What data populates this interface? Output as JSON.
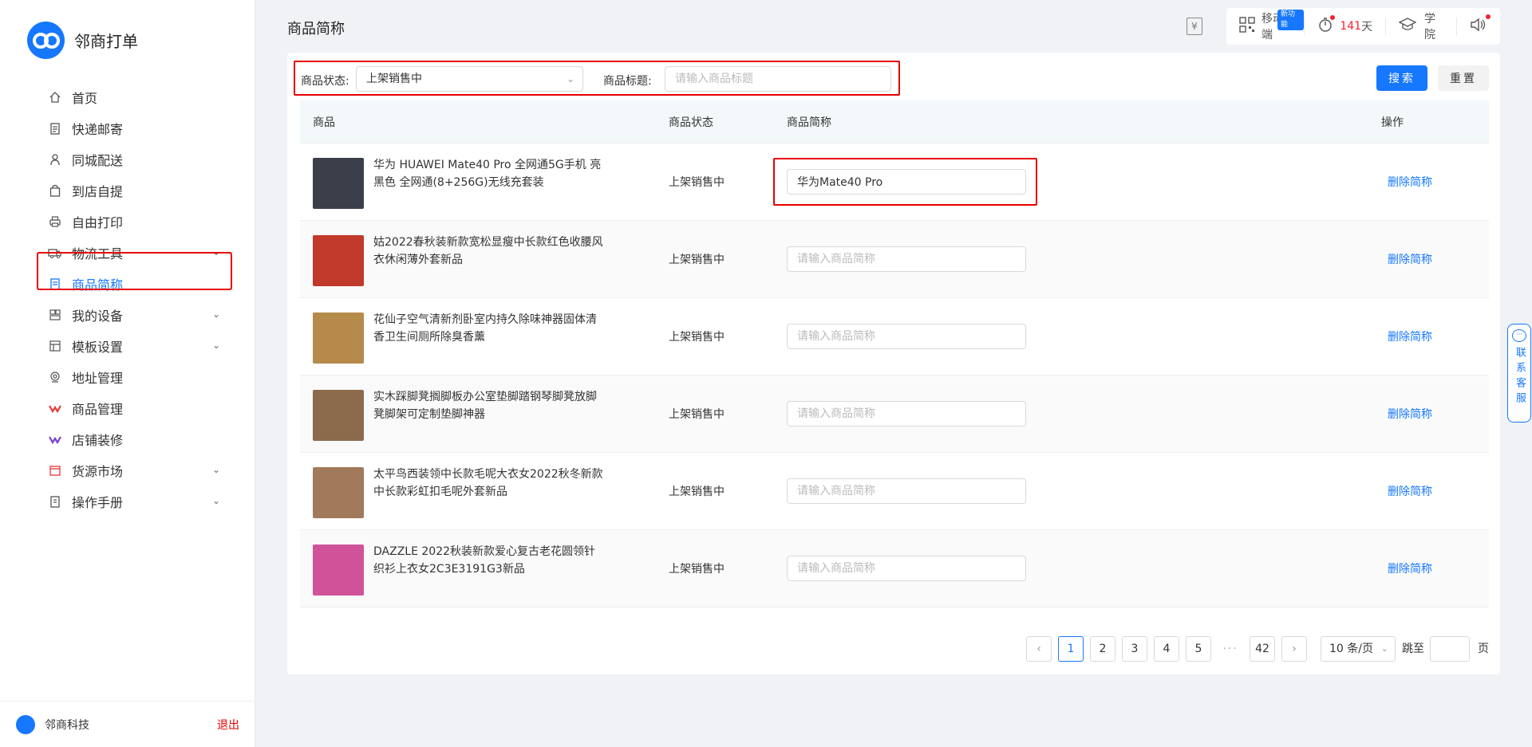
{
  "app": {
    "name": "邻商打单"
  },
  "sidebar": {
    "items": [
      {
        "label": "首页",
        "icon": "home-icon",
        "expandable": false
      },
      {
        "label": "快递邮寄",
        "icon": "clipboard-icon",
        "expandable": false
      },
      {
        "label": "同城配送",
        "icon": "person-icon",
        "expandable": false
      },
      {
        "label": "到店自提",
        "icon": "bag-icon",
        "expandable": false
      },
      {
        "label": "自由打印",
        "icon": "printer-icon",
        "expandable": false
      },
      {
        "label": "物流工具",
        "icon": "truck-icon",
        "expandable": true
      },
      {
        "label": "商品简称",
        "icon": "document-icon",
        "expandable": false,
        "active": true
      },
      {
        "label": "我的设备",
        "icon": "devices-icon",
        "expandable": true
      },
      {
        "label": "模板设置",
        "icon": "template-icon",
        "expandable": true
      },
      {
        "label": "地址管理",
        "icon": "location-icon",
        "expandable": false
      },
      {
        "label": "商品管理",
        "icon": "goods-icon",
        "expandable": false
      },
      {
        "label": "店铺装修",
        "icon": "shop-decor-icon",
        "expandable": false
      },
      {
        "label": "货源市场",
        "icon": "market-icon",
        "expandable": true
      },
      {
        "label": "操作手册",
        "icon": "manual-icon",
        "expandable": true
      }
    ],
    "footer": {
      "company": "邻商科技",
      "logout": "退出"
    }
  },
  "header": {
    "title": "商品简称",
    "toolbar": {
      "mobile_label": "移动端",
      "new_badge": "新功能",
      "timer_value": "141",
      "timer_unit": "天",
      "academy_label": "学院"
    }
  },
  "filters": {
    "status_label": "商品状态:",
    "status_value": "上架销售中",
    "title_label": "商品标题:",
    "title_placeholder": "请输入商品标题",
    "search_button": "搜索",
    "reset_button": "重置"
  },
  "table": {
    "columns": [
      "商品",
      "商品状态",
      "商品简称",
      "操作"
    ],
    "short_placeholder": "请输入商品简称",
    "delete_label": "删除简称",
    "rows": [
      {
        "name": "华为 HUAWEI Mate40 Pro 全网通5G手机 亮黑色 全网通(8+256G)无线充套装",
        "status": "上架销售中",
        "short_name": "华为Mate40 Pro",
        "thumb_color": "#3a3f4a"
      },
      {
        "name": "姑2022春秋装新款宽松显瘦中长款红色收腰风衣休闲薄外套新品",
        "status": "上架销售中",
        "short_name": "",
        "thumb_color": "#c0392b"
      },
      {
        "name": "花仙子空气清新剂卧室内持久除味神器固体清香卫生间厕所除臭香薰",
        "status": "上架销售中",
        "short_name": "",
        "thumb_color": "#b58a4a"
      },
      {
        "name": "实木踩脚凳搁脚板办公室垫脚踏钢琴脚凳放脚凳脚架可定制垫脚神器",
        "status": "上架销售中",
        "short_name": "",
        "thumb_color": "#8c6a4c"
      },
      {
        "name": "太平鸟西装领中长款毛呢大衣女2022秋冬新款中长款彩虹扣毛呢外套新品",
        "status": "上架销售中",
        "short_name": "",
        "thumb_color": "#a07a5a"
      },
      {
        "name": "DAZZLE 2022秋装新款爱心复古老花圆领针织衫上衣女2C3E3191G3新品",
        "status": "上架销售中",
        "short_name": "",
        "thumb_color": "#d0539a"
      }
    ]
  },
  "pagination": {
    "pages": [
      "1",
      "2",
      "3",
      "4",
      "5"
    ],
    "ellipsis": "···",
    "last_page": "42",
    "current": "1",
    "page_size": "10 条/页",
    "goto_label": "跳至",
    "page_label": "页"
  },
  "contact": {
    "label": "联系客服"
  },
  "colors": {
    "accent": "#1677ff",
    "danger": "#e60000"
  }
}
